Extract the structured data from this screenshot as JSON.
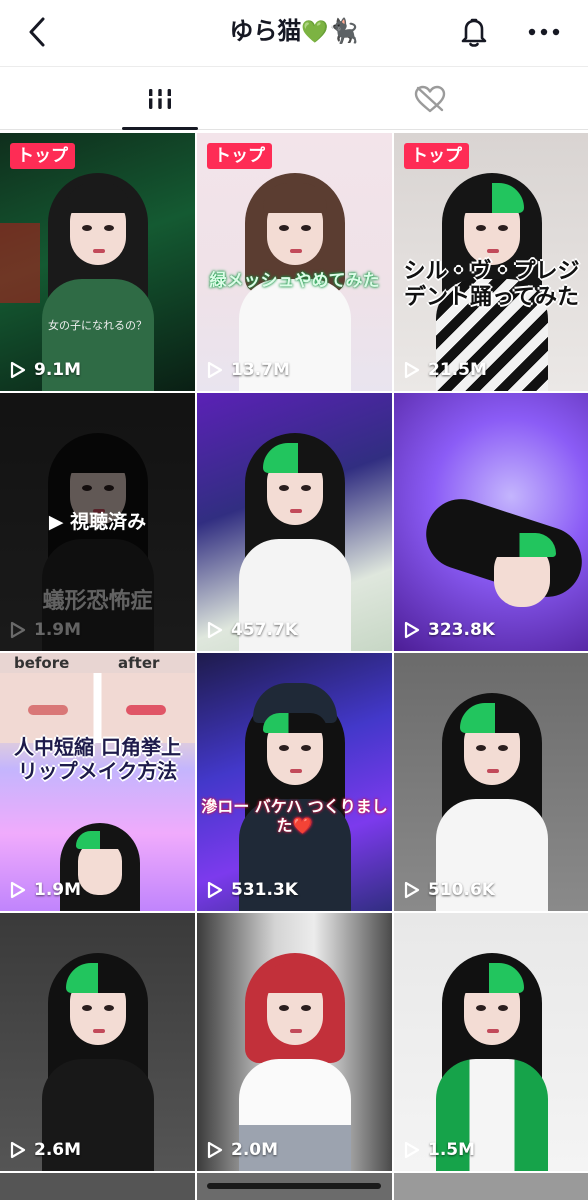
{
  "header": {
    "title": "ゆら猫",
    "title_emoji_heart": "💚",
    "title_emoji_cat": "🐈‍⬛",
    "back_icon": "chevron-left-icon",
    "bell_icon": "bell-icon",
    "more_icon": "more-horizontal-icon"
  },
  "tabs": {
    "videos_icon": "grid-bars-icon",
    "liked_icon": "heart-hidden-icon",
    "active": "videos"
  },
  "colors": {
    "badge": "#fe2c55",
    "text": "#161823",
    "neon_green": "#22c55e"
  },
  "videos": [
    {
      "badge": "トップ",
      "views": "9.1M",
      "caption": "女の子になれるの？"
    },
    {
      "badge": "トップ",
      "views": "13.7M",
      "caption": "緑メッシュやめてみた"
    },
    {
      "badge": "トップ",
      "views": "21.5M",
      "caption": "シル・ヴ・プレジデント踊ってみた"
    },
    {
      "views": "1.9M",
      "watched": "▶ 視聴済み",
      "caption": "蟻形恐怖症"
    },
    {
      "views": "457.7K"
    },
    {
      "views": "323.8K"
    },
    {
      "views": "1.9M",
      "caption_top_left": "before",
      "caption_top_right": "after",
      "caption": "人中短縮 口角挙上 リップメイク方法"
    },
    {
      "views": "531.3K",
      "caption": "滲ロー バケハ つくりました❤️"
    },
    {
      "views": "510.6K"
    },
    {
      "views": "2.6M"
    },
    {
      "views": "2.0M"
    },
    {
      "views": "1.5M"
    }
  ]
}
